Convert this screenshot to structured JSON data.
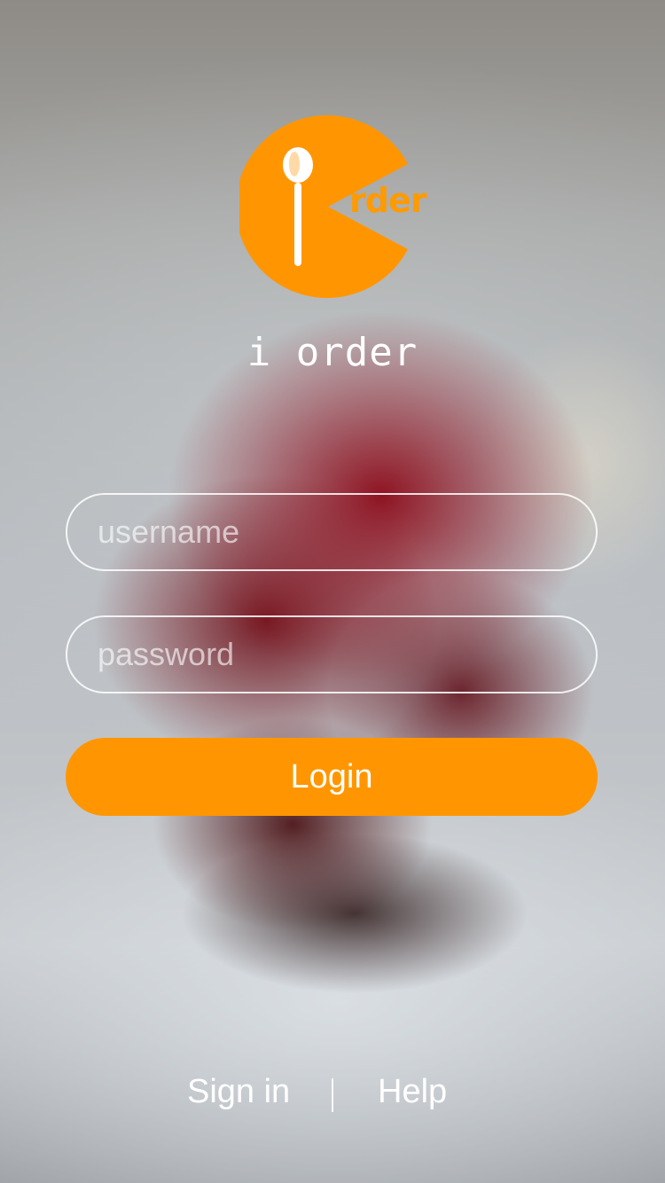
{
  "colors": {
    "accent": "#ff9601",
    "text": "#ffffff"
  },
  "logo": {
    "icon": "pacman-spoon-logo-icon",
    "word": "rder"
  },
  "brand": {
    "title": "i order"
  },
  "form": {
    "username_placeholder": "username",
    "username_value": "",
    "password_placeholder": "password",
    "password_value": "",
    "login_label": "Login"
  },
  "footer": {
    "sign_in_label": "Sign in",
    "help_label": "Help"
  }
}
